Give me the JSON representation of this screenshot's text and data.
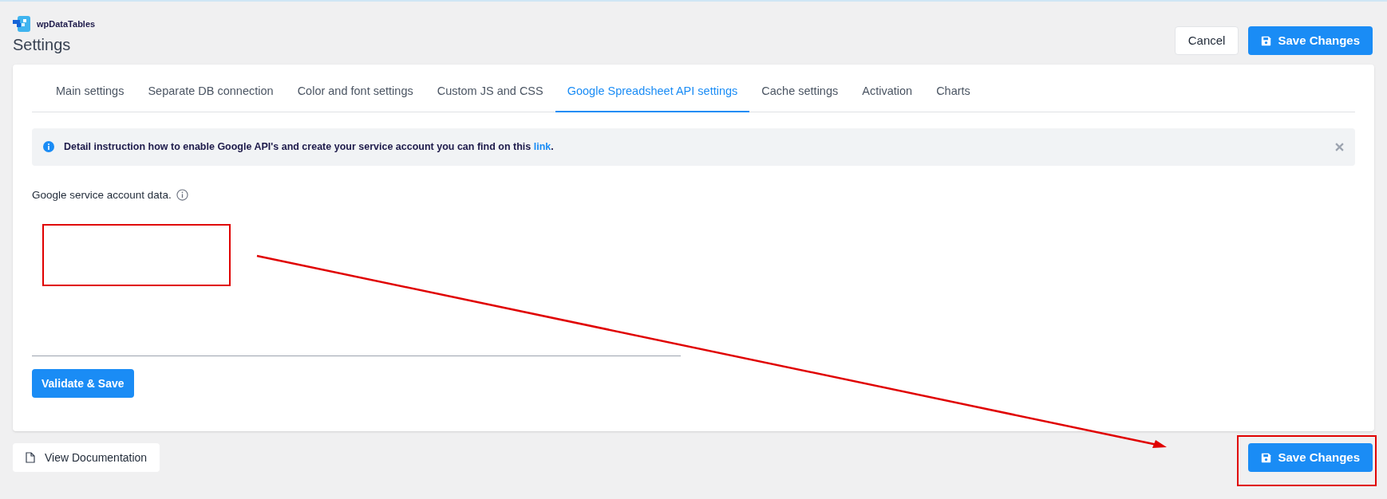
{
  "header": {
    "brand": "wpDataTables",
    "title": "Settings",
    "buttons": [
      {
        "kind": "secondary",
        "label": "Cancel"
      },
      {
        "kind": "primary",
        "label": "Save Changes"
      }
    ]
  },
  "tabs": [
    {
      "label": "Main settings",
      "selected": false
    },
    {
      "label": "Separate DB connection",
      "selected": false
    },
    {
      "label": "Color and font settings",
      "selected": false
    },
    {
      "label": "Custom JS and CSS",
      "selected": false
    },
    {
      "label": "Google Spreadsheet API settings",
      "selected": true
    },
    {
      "label": "Cache settings",
      "selected": false
    },
    {
      "label": "Activation",
      "selected": false
    },
    {
      "label": "Charts",
      "selected": false
    }
  ],
  "notice": {
    "text": "Detail instruction how to enable Google API's and create your service account you can find on this",
    "link": "link",
    "end": "."
  },
  "field": {
    "label": "Google service account data."
  },
  "validate_button": "Validate & Save",
  "footer": {
    "doc_button": "View Documentation",
    "save_button": "Save Changes"
  }
}
